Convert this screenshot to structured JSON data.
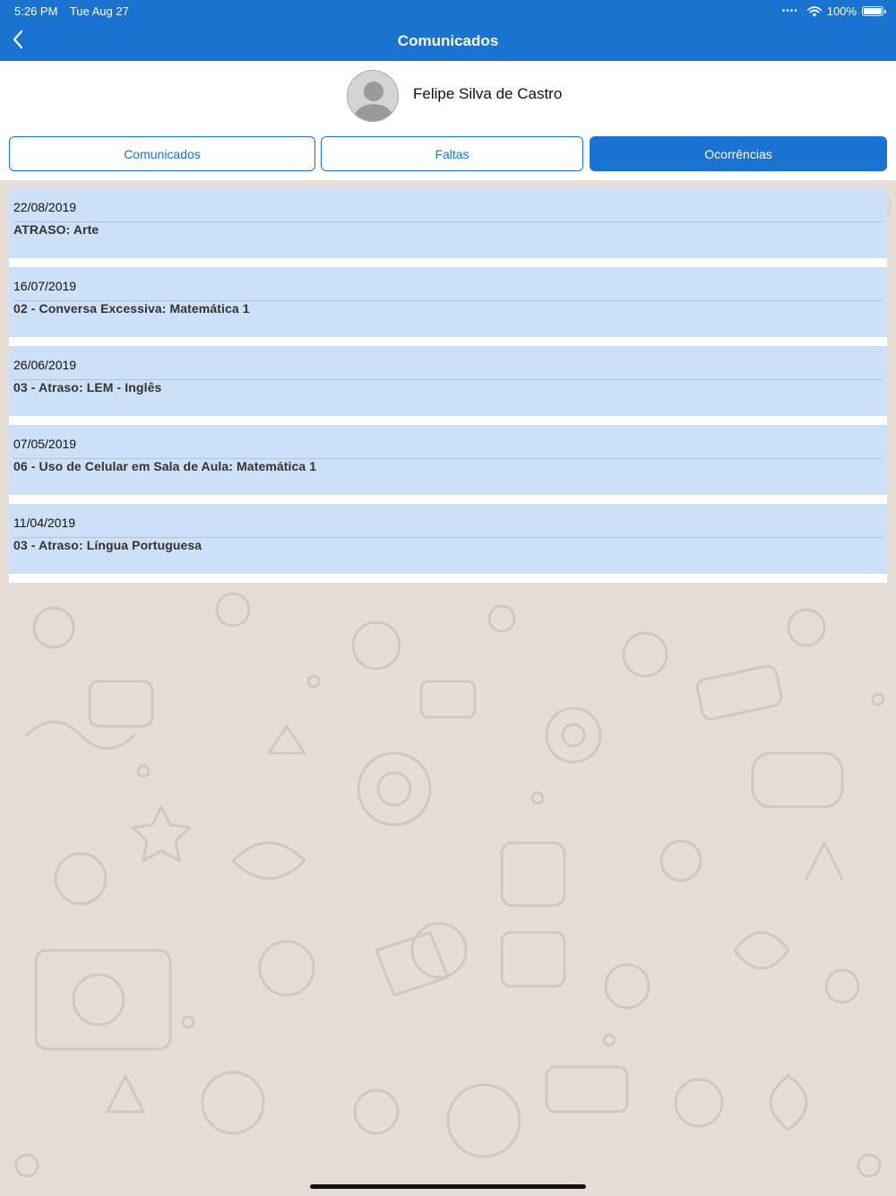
{
  "status_bar": {
    "time": "5:26 PM",
    "date": "Tue Aug 27",
    "battery": "100%",
    "wifi_icon": "wifi-icon",
    "battery_icon": "battery-icon"
  },
  "nav": {
    "title": "Comunicados",
    "back_icon": "chevron-left-icon"
  },
  "student": {
    "name": "Felipe Silva de Castro"
  },
  "tabs": [
    {
      "label": "Comunicados",
      "active": false
    },
    {
      "label": "Faltas",
      "active": false
    },
    {
      "label": "Ocorrências",
      "active": true
    }
  ],
  "occurrences": [
    {
      "date": "22/08/2019",
      "description": "ATRASO: Arte"
    },
    {
      "date": "16/07/2019",
      "description": "02 - Conversa Excessiva: Matemática 1"
    },
    {
      "date": "26/06/2019",
      "description": "03 - Atraso: LEM - Inglês"
    },
    {
      "date": "07/05/2019",
      "description": "06 - Uso de Celular em Sala de Aula: Matemática 1"
    },
    {
      "date": "11/04/2019",
      "description": "03 - Atraso: Língua Portuguesa"
    }
  ],
  "colors": {
    "primary": "#1a73d0",
    "item_background": "#cce0f7",
    "page_background": "#e6ddd4"
  }
}
